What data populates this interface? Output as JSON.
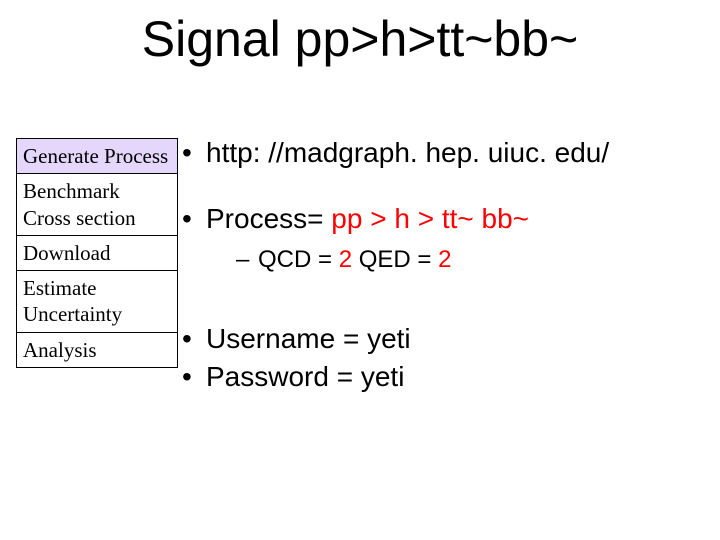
{
  "title": "Signal pp>h>tt~bb~",
  "sidebar": {
    "items": [
      {
        "label": "Generate Process"
      },
      {
        "label": "Benchmark Cross section"
      },
      {
        "label": "Download"
      },
      {
        "label": "Estimate Uncertainty"
      },
      {
        "label": "Analysis"
      }
    ]
  },
  "content": {
    "bullet1": "http: //madgraph. hep. uiuc. edu/",
    "bullet2_prefix": "Process= ",
    "bullet2_proc": "pp > h > tt~ bb~",
    "sub1_prefix": "QCD = ",
    "sub1_val1": "2",
    "sub1_mid": "  QED = ",
    "sub1_val2": "2",
    "bullet3": "Username = yeti",
    "bullet4": "Password  = yeti"
  }
}
